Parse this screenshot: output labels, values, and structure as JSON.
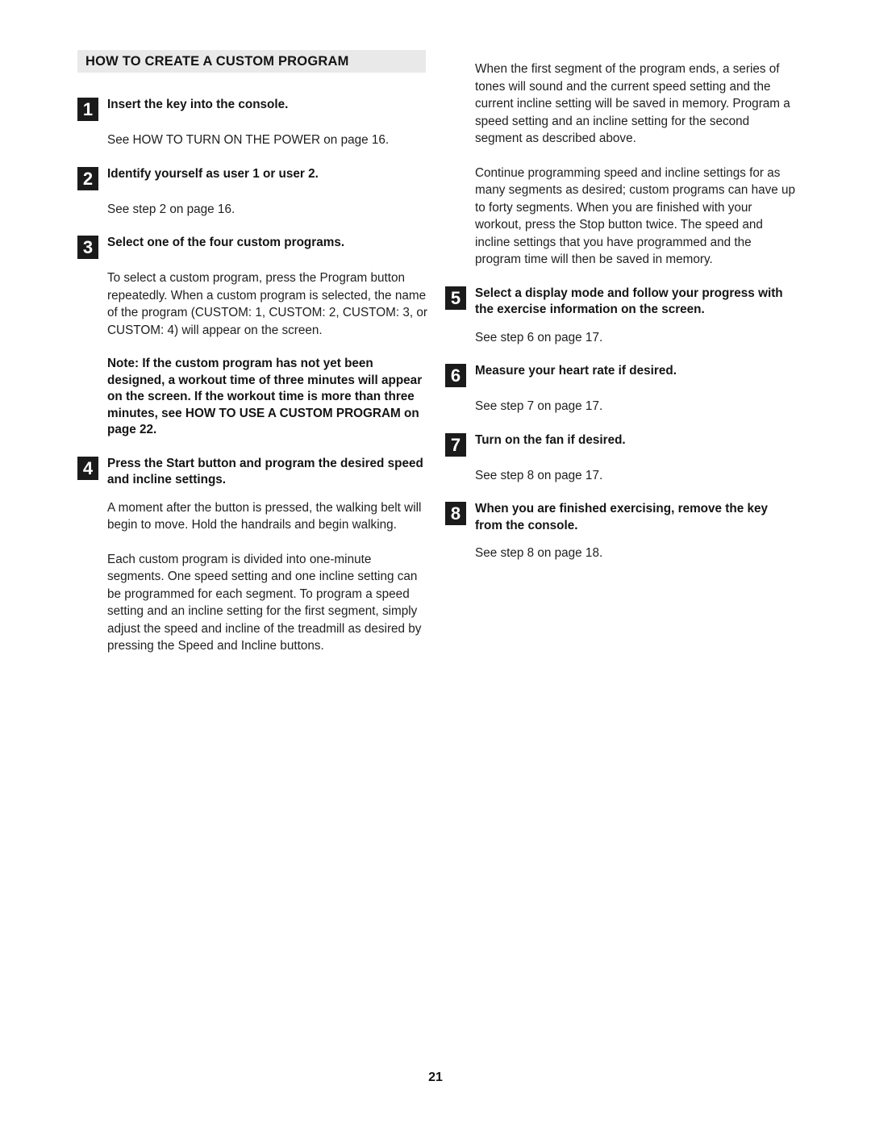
{
  "document": {
    "page_number": "21",
    "section_title": "HOW TO CREATE A CUSTOM PROGRAM"
  },
  "left_column": {
    "step1": {
      "number": "1",
      "title": "Insert the key into the console.",
      "body": "See HOW TO TURN ON THE POWER on page 16."
    },
    "step2": {
      "number": "2",
      "title": "Identify yourself as user 1 or user 2.",
      "body": "See step 2 on page 16."
    },
    "step3": {
      "number": "3",
      "title": "Select one of the four custom programs.",
      "body": "To select a custom program, press the Program button repeatedly. When a custom program is selected, the name of the program (CUSTOM: 1, CUSTOM: 2, CUSTOM: 3, or CUSTOM: 4) will appear on the screen.",
      "note": "Note: If the custom program has not yet been designed, a workout time of three minutes will appear on the screen. If the workout time is more than three minutes, see HOW TO USE A CUSTOM PROGRAM on page 22."
    },
    "step4": {
      "number": "4",
      "title": "Press the Start button and program the desired speed and incline settings.",
      "body1": "A moment after the button is pressed, the walking belt will begin to move. Hold the handrails and begin walking.",
      "body2": "Each custom program is divided into one-minute segments. One speed setting and one incline setting can be programmed for each segment. To program a speed setting and an incline setting for the first segment, simply adjust the speed and incline of the treadmill as desired by pressing the Speed and Incline buttons."
    }
  },
  "right_column": {
    "intro1": "When the first segment of the program ends, a series of tones will sound and the current speed setting and the current incline setting will be saved in memory. Program a speed setting and an incline setting for the second segment as described above.",
    "intro2": "Continue programming speed and incline settings for as many segments as desired; custom programs can have up to forty segments. When you are finished with your workout, press the Stop button twice. The speed and incline settings that you have programmed and the program time will then be saved in memory.",
    "step5": {
      "number": "5",
      "title": "Select a display mode and follow your progress with the exercise information on the screen.",
      "body": "See step 6 on page 17."
    },
    "step6": {
      "number": "6",
      "title": "Measure your heart rate if desired.",
      "body": "See step 7 on page 17."
    },
    "step7": {
      "number": "7",
      "title": "Turn on the fan if desired.",
      "body": "See step 8 on page 17."
    },
    "step8": {
      "number": "8",
      "title": "When you are finished exercising, remove the key from the console.",
      "body": "See step 8 on page 18."
    }
  }
}
